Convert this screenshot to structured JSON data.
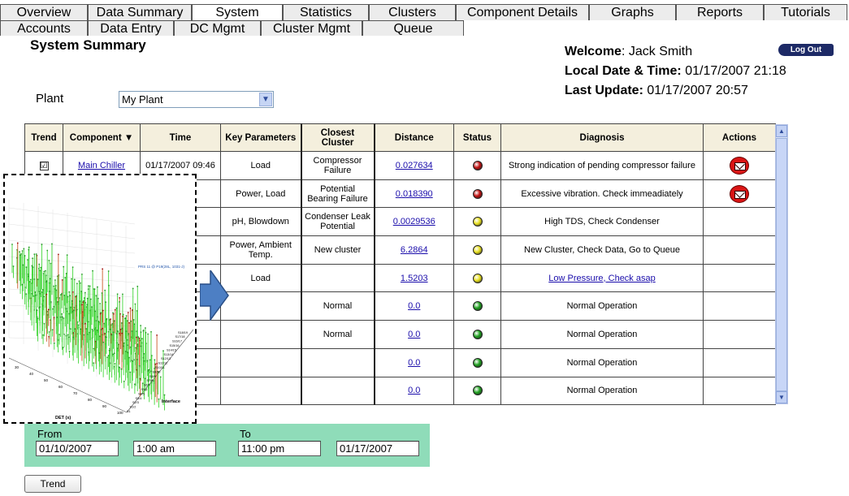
{
  "tabs_row1": [
    "Overview",
    "Data Summary",
    "System",
    "Statistics",
    "Clusters",
    "Component Details",
    "Graphs",
    "Reports",
    "Tutorials"
  ],
  "tabs_row2": [
    "Accounts",
    "Data Entry",
    "DC Mgmt",
    "Cluster Mgmt",
    "Queue"
  ],
  "active_tab": "System",
  "page_title": "System Summary",
  "header": {
    "welcome_label": "Welcome",
    "welcome_user": ": Jack Smith",
    "datetime_label": "Local Date & Time:",
    "datetime_value": " 01/17/2007 21:18",
    "update_label": "Last Update:",
    "update_value": " 01/17/2007 20:57",
    "logout_label": "Log Out"
  },
  "plant": {
    "label": "Plant",
    "selected": "My Plant"
  },
  "table": {
    "headers": [
      "Trend",
      "Component ▼",
      "Time",
      "Key Parameters",
      "Closest Cluster",
      "Distance",
      "Status",
      "Diagnosis",
      "Actions"
    ],
    "rows": [
      {
        "trend": "☑",
        "component": "Main Chiller",
        "time": "01/17/2007 09:46",
        "params": "Load",
        "cluster": "Compressor Failure",
        "distance": "0.027634",
        "status": "red",
        "diagnosis": "Strong indication of pending compressor failure",
        "action": "email"
      },
      {
        "trend": "",
        "component": "",
        "time": "",
        "params": "Power, Load",
        "cluster": "Potential Bearing Failure",
        "distance": "0.018390",
        "status": "red",
        "diagnosis": "Excessive vibration. Check immeadiately",
        "action": "email"
      },
      {
        "trend": "",
        "component": "",
        "time": "",
        "params": "pH, Blowdown",
        "cluster": "Condenser Leak Potential",
        "distance": "0.0029536",
        "status": "yellow",
        "diagnosis": "High TDS, Check Condenser",
        "action": ""
      },
      {
        "trend": "",
        "component": "",
        "time": "",
        "params": "Power, Ambient Temp.",
        "cluster": "New cluster",
        "distance": "6.2864",
        "status": "yellow",
        "diagnosis": "New Cluster, Check Data, Go to Queue",
        "action": ""
      },
      {
        "trend": "",
        "component": "",
        "time": "",
        "params": "Load",
        "cluster": "",
        "distance": "1.5203",
        "status": "yellow",
        "diagnosis": "Low Pressure, Check asap",
        "diagnosis_link": true,
        "action": ""
      },
      {
        "trend": "",
        "component": "",
        "time": "",
        "params": "",
        "cluster": "Normal",
        "distance": "0.0",
        "status": "green",
        "diagnosis": "Normal Operation",
        "action": ""
      },
      {
        "trend": "",
        "component": "",
        "time": "",
        "params": "",
        "cluster": "Normal",
        "distance": "0.0",
        "status": "green",
        "diagnosis": "Normal Operation",
        "action": ""
      },
      {
        "trend": "",
        "component": "",
        "time": "",
        "params": "",
        "cluster": "",
        "distance": "0.0",
        "status": "green",
        "diagnosis": "Normal Operation",
        "action": ""
      },
      {
        "trend": "",
        "component": "",
        "time": "",
        "params": "",
        "cluster": "",
        "distance": "0.0",
        "status": "green",
        "diagnosis": "Normal Operation",
        "action": ""
      }
    ]
  },
  "status_colors": {
    "red": "#c01010",
    "yellow": "#e8e020",
    "green": "#1fa01f"
  },
  "plot": {
    "annotation": "PRS 11 @ P19(28L, 1031-J)",
    "axis_x_label": "DET (s)",
    "axis_z_label": "Interface",
    "x_ticks": [
      "30",
      "40",
      "50",
      "60",
      "70",
      "80",
      "90",
      "100"
    ],
    "z_ticks": [
      "S1",
      "S1/2",
      "S2/3",
      "S3/4",
      "S4/5",
      "S5/6",
      "S6/7",
      "S7/8",
      "S8/9",
      "S9/10",
      "S10/11",
      "S11/12",
      "S12/13",
      "S13/14",
      "S14/15",
      "S15/16",
      "S16/17",
      "S17/18",
      "S18/19"
    ]
  },
  "dates": {
    "from_label": "From",
    "to_label": "To",
    "from_date": "01/10/2007",
    "from_time": "1:00 am",
    "to_time": "11:00 pm",
    "to_date": "01/17/2007"
  },
  "trend_button": "Trend"
}
